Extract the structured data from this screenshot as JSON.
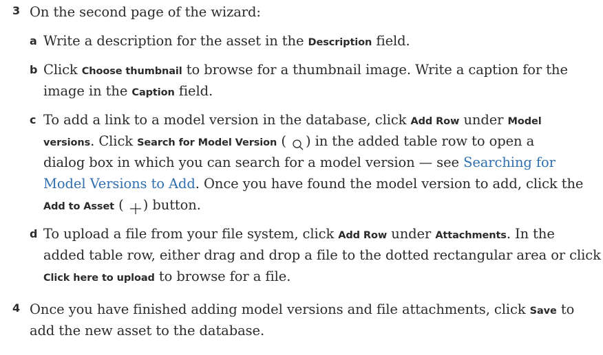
{
  "steps": {
    "s3": {
      "num": "3",
      "text": "On the second page of the wizard:",
      "a": {
        "letter": "a",
        "t1": "Write a description for the asset in the ",
        "b1": "Description",
        "t2": " field."
      },
      "b": {
        "letter": "b",
        "t1": "Click ",
        "b1": "Choose thumbnail",
        "t2": " to browse for a thumbnail image. Write a caption for the",
        "t3": "image in the ",
        "b2": "Caption",
        "t4": " field."
      },
      "c": {
        "letter": "c",
        "t1": "To add a link to a model version in the database, click ",
        "b1": "Add Row",
        "t2": " under ",
        "b2": "Model",
        "b3": "versions",
        "t3": ". Click ",
        "b4": "Search for Model Version",
        "t4": " (",
        "search_icon": "search-icon",
        "t5": ") in the added table row to open a",
        "t6": "dialog box in which you can search for a model version — see ",
        "link1": "Searching for",
        "link2": "Model Versions to Add",
        "t7": ". Once you have found the model version to add, click the",
        "b5": "Add to Asset",
        "t8": " (",
        "plus_icon": "plus-icon",
        "t9": ") button."
      },
      "d": {
        "letter": "d",
        "t1": "To upload a file from your file system, click ",
        "b1": "Add Row",
        "t2": " under ",
        "b2": "Attachments",
        "t3": ". In the",
        "t4": "added table row, either drag and drop a file to the dotted rectangular area or click",
        "b3": "Click here to upload",
        "t5": " to browse for a file."
      }
    },
    "s4": {
      "num": "4",
      "t1": "Once you have finished adding model versions and file attachments, click ",
      "b1": "Save",
      "t2": " to",
      "t3": "add the new asset to the database."
    }
  },
  "colors": {
    "text": "#2b2b2b",
    "link": "#2f6fb0"
  }
}
